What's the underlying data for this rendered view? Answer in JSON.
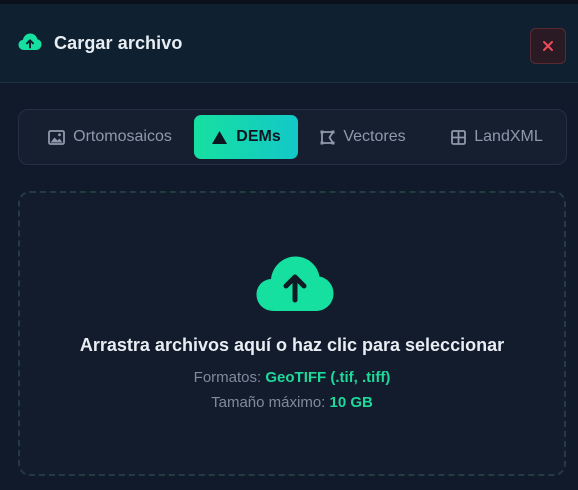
{
  "dialog": {
    "title": "Cargar archivo",
    "header_icon": "cloud-upload-icon",
    "close_icon": "close-icon",
    "close_symbol": "✕"
  },
  "tabs": [
    {
      "label": "Ortomosaicos",
      "icon": "image-icon",
      "active": false
    },
    {
      "label": "DEMs",
      "icon": "mountain-icon",
      "active": true
    },
    {
      "label": "Vectores",
      "icon": "vector-icon",
      "active": false
    },
    {
      "label": "LandXML",
      "icon": "grid-icon",
      "active": false
    }
  ],
  "dropzone": {
    "icon": "cloud-upload-icon",
    "title": "Arrastra archivos aquí o haz clic para seleccionar",
    "formats_label": "Formatos:",
    "formats_value": "GeoTIFF (.tif, .tiff)",
    "max_size_label": "Tamaño máximo:",
    "max_size_value": "10 GB"
  },
  "colors": {
    "accent": "#16e0a0",
    "accent_alt": "#13c8c8",
    "background": "#111a2b",
    "danger": "#ef4a5a"
  }
}
